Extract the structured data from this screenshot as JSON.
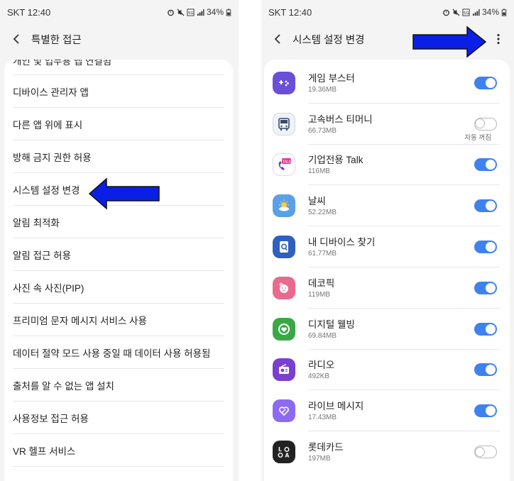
{
  "left": {
    "status": {
      "carrier": "SKT 12:40",
      "battery": "34%"
    },
    "title": "특별한 접근",
    "items": [
      "개인 및 업무용 앱 연결됨",
      "디바이스 관리자 앱",
      "다른 앱 위에 표시",
      "방해 금지 권한 허용",
      "시스템 설정 변경",
      "알림 최적화",
      "알림 접근 허용",
      "사진 속 사진(PIP)",
      "프리미엄 문자 메시지 서비스 사용",
      "데이터 절약 모드 사용 중일 때 데이터 사용 허용됨",
      "출처를 알 수 없는 앱 설치",
      "사용정보 접근 허용",
      "VR 헬프 서비스"
    ]
  },
  "right": {
    "status": {
      "carrier": "SKT 12:40",
      "battery": "34%"
    },
    "title": "시스템 설정 변경",
    "apps": [
      {
        "name": "게임 부스터",
        "size": "19.36MB",
        "on": true,
        "icon": "game-booster-icon",
        "color": "#6b4fd8"
      },
      {
        "name": "고속버스 티머니",
        "size": "66.73MB",
        "on": false,
        "sub": "자동 꺼짐",
        "icon": "bus-icon",
        "color": "#3b4a6b"
      },
      {
        "name": "기업전용 Talk",
        "size": "116MB",
        "on": true,
        "icon": "talk-icon",
        "color": "#e03a8c"
      },
      {
        "name": "날씨",
        "size": "52.22MB",
        "on": true,
        "icon": "weather-icon",
        "color": "#5aa0e6"
      },
      {
        "name": "내 디바이스 찾기",
        "size": "61.77MB",
        "on": true,
        "icon": "find-device-icon",
        "color": "#2f5fbf"
      },
      {
        "name": "데코픽",
        "size": "119MB",
        "on": true,
        "icon": "decopic-icon",
        "color": "#e86b8e"
      },
      {
        "name": "디지털 웰빙",
        "size": "69.84MB",
        "on": true,
        "icon": "digital-wellbeing-icon",
        "color": "#3aa845"
      },
      {
        "name": "라디오",
        "size": "492KB",
        "on": true,
        "icon": "radio-icon",
        "color": "#7b3fd0"
      },
      {
        "name": "라이브 메시지",
        "size": "17.43MB",
        "on": true,
        "icon": "live-message-icon",
        "color": "#8d6bf0"
      },
      {
        "name": "롯데카드",
        "size": "197MB",
        "on": false,
        "icon": "lotte-card-icon",
        "color": "#222222"
      }
    ]
  },
  "colors": {
    "toggle_on": "#3e82f0",
    "arrow": "#0a1fe6"
  }
}
